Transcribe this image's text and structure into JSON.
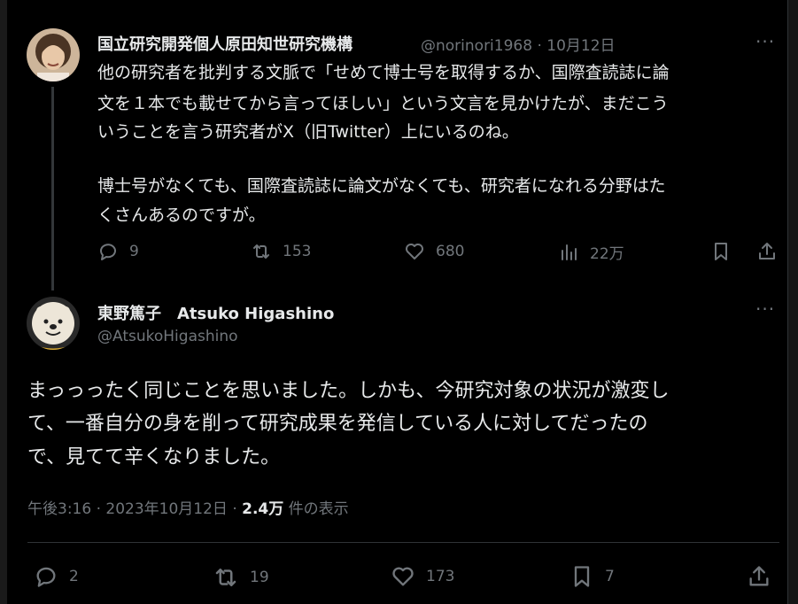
{
  "tweet1": {
    "display_name": "国立研究開発個人原田知世研究機構",
    "handle": "@norinori1968",
    "sep": "·",
    "date": "10月12日",
    "more": "···",
    "lines": [
      "他の研究者を批判する文脈で「せめて博士号を取得するか、国際査読誌に論",
      "文を１本でも載せてから言ってほしい」という文言を見かけたが、まだこう",
      "いうことを言う研究者がX（旧Twitter）上にいるのね。",
      "博士号がなくても、国際査読誌に論文がなくても、研究者になれる分野はた",
      "くさんあるのですが。"
    ],
    "actions": {
      "reply": "9",
      "retweet": "153",
      "like": "680",
      "views": "22万"
    }
  },
  "tweet2": {
    "display_name": "東野篤子　Atsuko Higashino",
    "handle": "@AtsukoHigashino",
    "more": "···",
    "lines": [
      "まっっったく同じことを思いました。しかも、今研究対象の状況が激変し",
      "て、一番自分の身を削って研究成果を発信している人に対してだったの",
      "で、見てて辛くなりました。"
    ],
    "timestamp": "午後3:16 · 2023年10月12日 · ",
    "views_count": "2.4万",
    "views_label": " 件の表示",
    "actions": {
      "reply": "2",
      "retweet": "19",
      "like": "173",
      "bookmark": "7"
    }
  },
  "colors": {
    "bg": "#000000",
    "text": "#e7e9ea",
    "muted": "#71767b",
    "border": "#2f3336"
  },
  "icons": [
    "reply-icon",
    "retweet-icon",
    "like-icon",
    "views-icon",
    "bookmark-icon",
    "share-icon",
    "more-icon"
  ]
}
